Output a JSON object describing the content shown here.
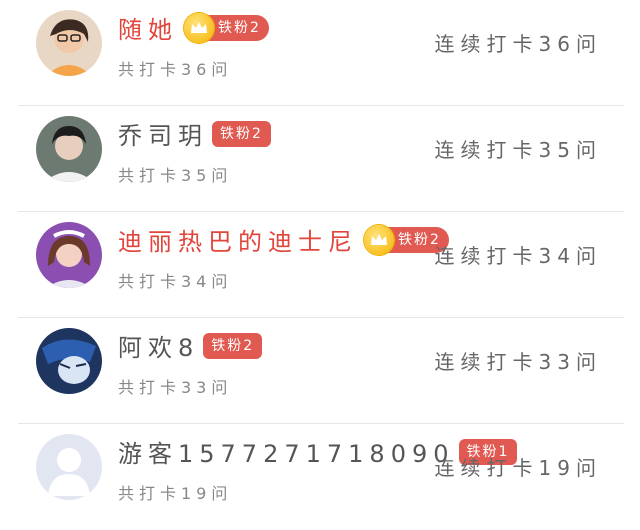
{
  "users": [
    {
      "name": "随她",
      "name_color": "red",
      "crown": true,
      "badge": "铁粉2",
      "total": "共打卡36问",
      "streak": "连续打卡36问",
      "avatar": "woman-glasses"
    },
    {
      "name": "乔司玥",
      "name_color": "gray",
      "crown": false,
      "badge": "铁粉2",
      "total": "共打卡35问",
      "streak": "连续打卡35问",
      "avatar": "young-man"
    },
    {
      "name": "迪丽热巴的迪士尼",
      "name_color": "red",
      "crown": true,
      "badge": "铁粉2",
      "total": "共打卡34问",
      "streak": "连续打卡34问",
      "avatar": "girl-headband"
    },
    {
      "name": "阿欢8",
      "name_color": "gray",
      "crown": false,
      "badge": "铁粉2",
      "total": "共打卡33问",
      "streak": "连续打卡33问",
      "avatar": "anime-character"
    },
    {
      "name": "游客15772717180​90",
      "name_color": "gray",
      "crown": false,
      "badge": "铁粉1",
      "total": "共打卡19问",
      "streak": "连续打卡19问",
      "avatar": "default-user"
    }
  ],
  "colors": {
    "accent_red": "#e2453c",
    "badge_bg": "#e05a52",
    "crown_gold": "#f5b400"
  }
}
